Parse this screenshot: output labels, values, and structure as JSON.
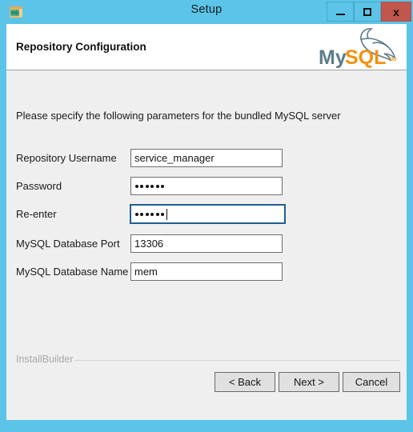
{
  "window": {
    "title": "Setup",
    "icon": "installer-icon",
    "frame_color": "#5bc4e8",
    "controls": {
      "minimize": "minimize-icon",
      "maximize": "maximize-icon",
      "close": "x",
      "close_color": "#c0564c"
    }
  },
  "header": {
    "title": "Repository Configuration",
    "logo": "mysql-logo",
    "logo_text_primary": "My",
    "logo_text_accent": "SQL",
    "logo_primary_color": "#5d7c8a",
    "logo_accent_color": "#f29111"
  },
  "main": {
    "intro": "Please specify the following parameters for the bundled MySQL server",
    "fields": [
      {
        "label": "Repository Username",
        "value": "service_manager",
        "type": "text",
        "focused": false
      },
      {
        "label": "Password",
        "value": "••••••",
        "masked_chars": 6,
        "type": "password",
        "focused": false
      },
      {
        "label": "Re-enter",
        "value": "••••••",
        "masked_chars": 6,
        "type": "password",
        "focused": true
      },
      {
        "label": "MySQL Database Port",
        "value": "13306",
        "type": "text",
        "focused": false
      },
      {
        "label": "MySQL Database Name",
        "value": "mem",
        "type": "text",
        "focused": false
      }
    ]
  },
  "footer": {
    "brand": "InstallBuilder",
    "buttons": {
      "back": "< Back",
      "next": "Next >",
      "cancel": "Cancel"
    }
  }
}
